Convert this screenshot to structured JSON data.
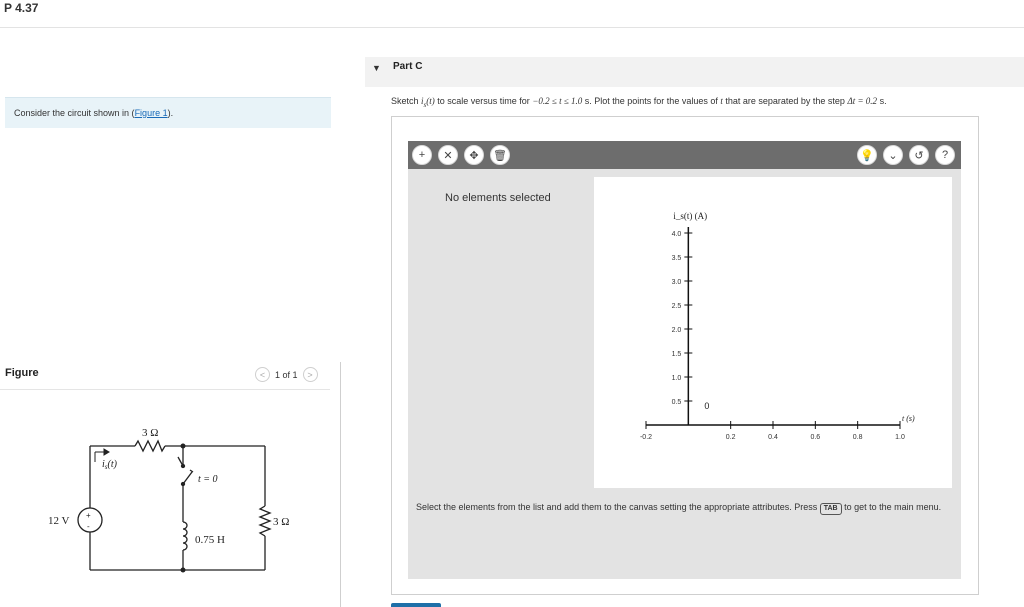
{
  "page": {
    "title": "P 4.37"
  },
  "intro": {
    "prefix": "Consider the circuit shown in (",
    "link": "Figure 1",
    "suffix": ")."
  },
  "figure": {
    "label": "Figure",
    "pager": "1 of 1",
    "prev": "<",
    "next": ">"
  },
  "circuit": {
    "source_label": "12 V",
    "plus": "+",
    "minus": "-",
    "r1": "3 Ω",
    "current_label": "i",
    "current_sub": "s",
    "current_arg": "(t)",
    "switch_label": "t = 0",
    "inductor": "0.75 H",
    "r2": "3 Ω"
  },
  "part": {
    "caret": "▼",
    "title": "Part C"
  },
  "instruction": {
    "a": "Sketch ",
    "var": "i",
    "sub": "s",
    "arg": "(t)",
    "b": " to scale versus time for ",
    "range": "−0.2 ≤ t ≤ 1.0",
    "c": " s. Plot the points for the values of ",
    "t": "t",
    "d": " that are separated by the step ",
    "step": "Δt = 0.2",
    "e": " s."
  },
  "toolbar": {
    "add": "+",
    "no_select": "✕",
    "move": "✥",
    "trash": "🗑",
    "hint": "💡",
    "dropdown": "⌄",
    "reset": "↺",
    "help": "?"
  },
  "canvas": {
    "status": "No elements selected",
    "help_a": "Select the elements from the list and add them to the canvas setting the appropriate attributes. Press ",
    "tab_key": "TAB",
    "help_b": " to get to the main menu."
  },
  "chart_data": {
    "type": "scatter",
    "ylabel": "i_s(t) (A)",
    "xlabel": "t (s)",
    "xlim": [
      -0.2,
      1.0
    ],
    "ylim": [
      0,
      4.0
    ],
    "x_ticks": [
      "-0.2",
      "0.2",
      "0.4",
      "0.6",
      "0.8",
      "1.0"
    ],
    "x_tick_values": [
      -0.2,
      0.2,
      0.4,
      0.6,
      0.8,
      1.0
    ],
    "y_ticks": [
      "0.5",
      "1.0",
      "1.5",
      "2.0",
      "2.5",
      "3.0",
      "3.5",
      "4.0"
    ],
    "y_tick_values": [
      0.5,
      1.0,
      1.5,
      2.0,
      2.5,
      3.0,
      3.5,
      4.0
    ],
    "origin_label": "0",
    "series": []
  }
}
